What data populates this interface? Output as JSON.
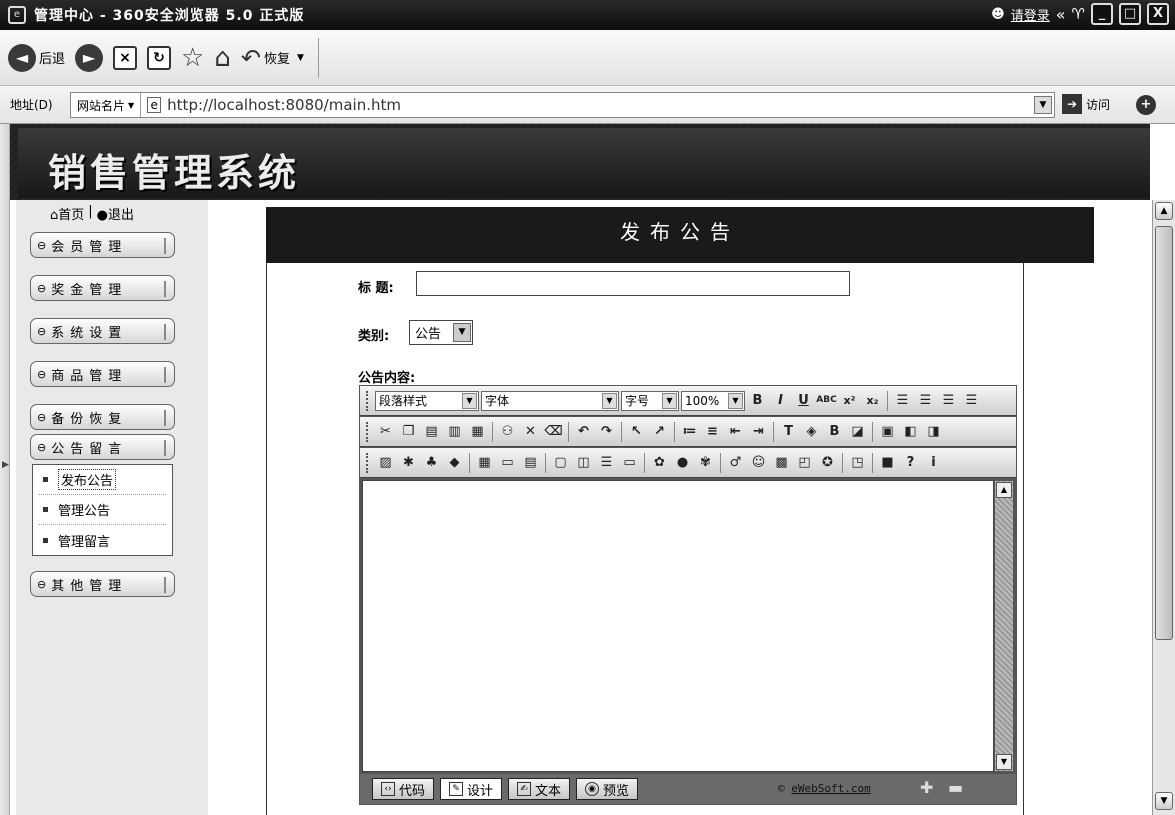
{
  "window": {
    "title": "管理中心 - 360安全浏览器 5.0 正式版",
    "login": "请登录",
    "chevron": "«",
    "minimize": "_",
    "maximize": "□",
    "close": "X"
  },
  "toolbar": {
    "back_label": "后退",
    "restore_label": "恢复"
  },
  "address": {
    "label": "地址(D)",
    "favorites": "网站名片",
    "url": "http://localhost:8080/main.htm",
    "visit": "访问"
  },
  "banner": {
    "title": "销售管理系统"
  },
  "sidebar": {
    "home": "首页",
    "divider": "|",
    "logout": "退出",
    "menus": [
      {
        "label": "会员管理"
      },
      {
        "label": "奖金管理"
      },
      {
        "label": "系统设置"
      },
      {
        "label": "商品管理"
      },
      {
        "label": "备份恢复"
      },
      {
        "label": "公告留言"
      },
      {
        "label": "其他管理"
      }
    ],
    "submenu": [
      {
        "label": "发布公告"
      },
      {
        "label": "管理公告"
      },
      {
        "label": "管理留言"
      }
    ]
  },
  "form": {
    "header": "发布公告",
    "title_label": "标 题:",
    "title_value": "",
    "category_label": "类别:",
    "category_value": "公告",
    "content_label": "公告内容:"
  },
  "editor": {
    "paragraph_style": "段落样式",
    "font": "字体",
    "font_size": "字号",
    "zoom": "100%",
    "modes": [
      {
        "label": "代码"
      },
      {
        "label": "设计"
      },
      {
        "label": "文本"
      },
      {
        "label": "预览"
      }
    ],
    "credit": "eWebSoft.com",
    "copyright": "©"
  },
  "colors": {
    "titlebar": "#111111",
    "banner": "#222222",
    "form_header": "#1a1a1a",
    "sidebar": "#e9e9e9"
  }
}
